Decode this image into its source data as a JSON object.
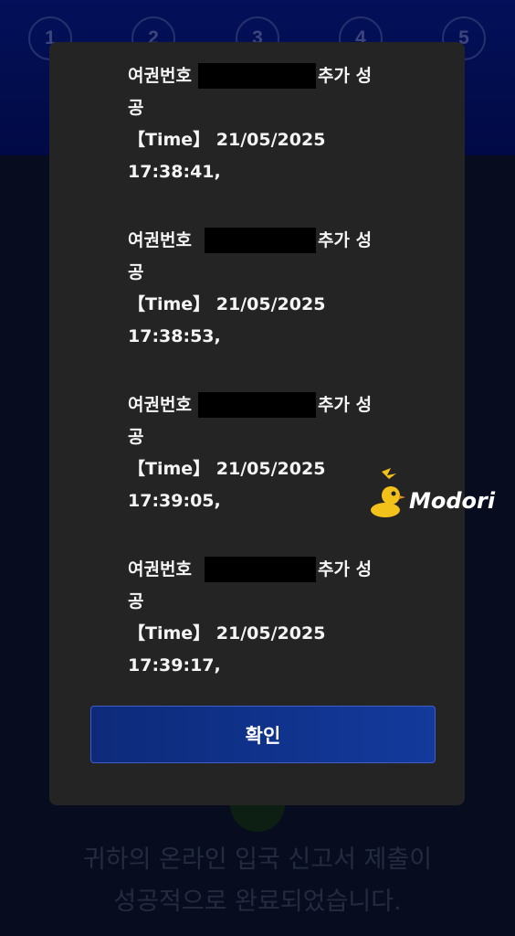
{
  "stepper": {
    "steps": [
      "1",
      "2",
      "3",
      "4",
      "5"
    ]
  },
  "background": {
    "message_line1": "귀하의 온라인 입국 신고서 제출이",
    "message_line2": "성공적으로 완료되었습니다."
  },
  "dialog": {
    "entries": [
      {
        "label": "여권번호",
        "suffix": "추가 성",
        "line2": "공",
        "time_line": "【Time】 21/05/2025",
        "time": "17:38:41,"
      },
      {
        "label": "여권번호",
        "suffix": "추가 성",
        "line2": "공",
        "time_line": "【Time】 21/05/2025",
        "time": "17:38:53,"
      },
      {
        "label": "여권번호",
        "suffix": "추가 성",
        "line2": "공",
        "time_line": "【Time】 21/05/2025",
        "time": "17:39:05,"
      },
      {
        "label": "여권번호",
        "suffix": "추가 성",
        "line2": "공",
        "time_line": "【Time】 21/05/2025",
        "time": "17:39:17,"
      }
    ],
    "confirm_label": "확인"
  },
  "watermark": {
    "text": "Modori"
  },
  "colors": {
    "dialog_bg": "#242424",
    "button_bg": "#133a9c",
    "top_band": "#061a8a"
  }
}
